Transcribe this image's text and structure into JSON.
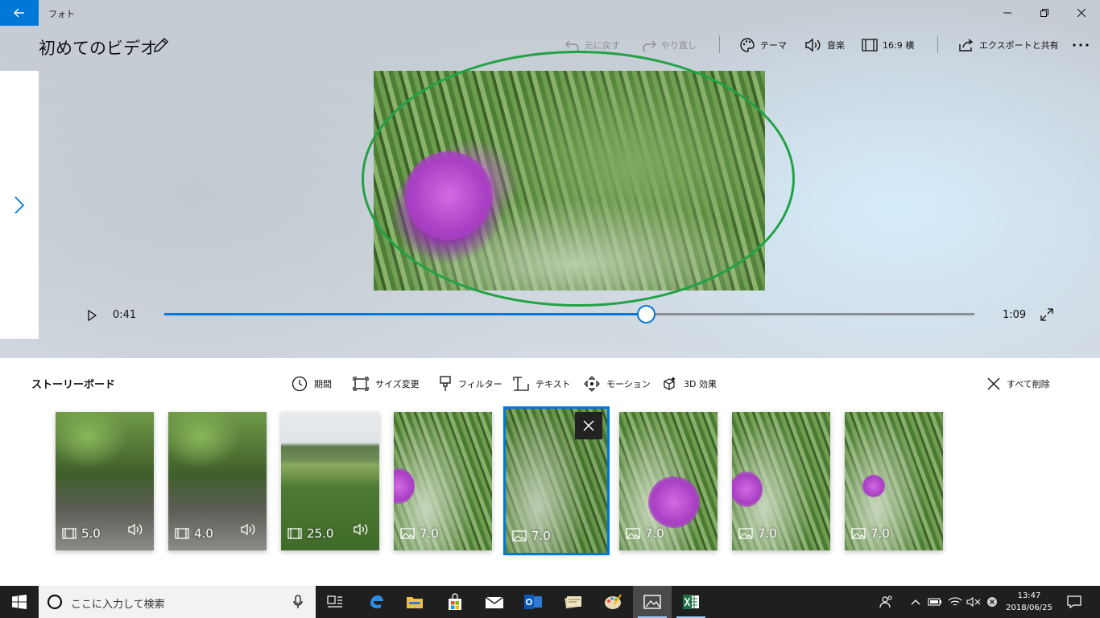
{
  "app": {
    "title": "フォト"
  },
  "project": {
    "title": "初めてのビデオ"
  },
  "commands": {
    "undo": "元に戻す",
    "redo": "やり直し",
    "theme": "テーマ",
    "music": "音楽",
    "aspect": "16:9 横",
    "export": "エクスポートと共有"
  },
  "playback": {
    "current": "0:41",
    "total": "1:09",
    "progress": 0.594
  },
  "storyboard": {
    "title": "ストーリーボード",
    "tools": {
      "duration": "期間",
      "resize": "サイズ変更",
      "filter": "フィルター",
      "text": "テキスト",
      "motion": "モーション",
      "effects3d": "3D 効果",
      "remove_all": "すべて削除"
    },
    "clips": [
      {
        "duration": "5.0",
        "type": "video",
        "audio": true
      },
      {
        "duration": "4.0",
        "type": "video",
        "audio": true
      },
      {
        "duration": "25.0",
        "type": "video",
        "audio": true
      },
      {
        "duration": "7.0",
        "type": "photo",
        "audio": false
      },
      {
        "duration": "7.0",
        "type": "photo",
        "audio": false,
        "selected": true
      },
      {
        "duration": "7.0",
        "type": "photo",
        "audio": false
      },
      {
        "duration": "7.0",
        "type": "photo",
        "audio": false
      },
      {
        "duration": "7.0",
        "type": "photo",
        "audio": false
      }
    ]
  },
  "taskbar": {
    "search_placeholder": "ここに入力して検索",
    "time": "13:47",
    "date": "2018/06/25"
  },
  "colors": {
    "accent": "#0078d7",
    "annotation": "#22a246",
    "taskbar": "#1f1f1f"
  }
}
